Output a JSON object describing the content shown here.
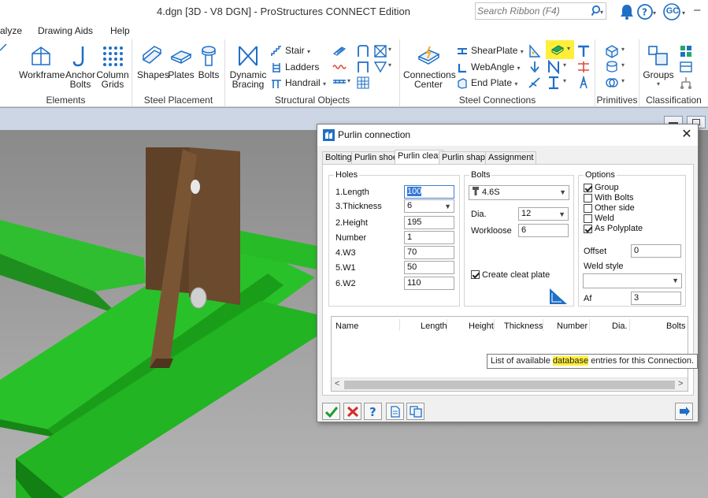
{
  "titlebar": {
    "title": "4.dgn [3D - V8 DGN] - ProStructures CONNECT Edition",
    "search_placeholder": "Search Ribbon (F4)",
    "user_initials": "GC"
  },
  "menu": {
    "tabs": [
      "alyze",
      "Drawing Aids",
      "Help"
    ]
  },
  "ribbon": {
    "elements": {
      "label": "Elements",
      "buttons": [
        "Workframe",
        "Anchor",
        "Bolts",
        "Column",
        "Grids"
      ]
    },
    "steel_placement": {
      "label": "Steel Placement",
      "buttons": [
        "Shapes",
        "Plates",
        "Bolts"
      ]
    },
    "structural_objects": {
      "label": "Structural Objects",
      "dynamic": [
        "Dynamic",
        "Bracing"
      ],
      "stair": "Stair",
      "ladders": "Ladders",
      "handrail": "Handrail"
    },
    "steel_connections": {
      "label": "Steel Connections",
      "center": [
        "Connections",
        "Center"
      ],
      "shearplate": "ShearPlate",
      "webangle": "WebAngle",
      "endplate": "End Plate"
    },
    "primitives": {
      "label": "Primitives"
    },
    "classification": {
      "label": "Classification",
      "groups": "Groups"
    }
  },
  "dialog": {
    "title": "Purlin connection",
    "tabs": [
      "Bolting",
      "Purlin shoe",
      "Purlin cleat",
      "Purlin shape",
      "Assignment"
    ],
    "holes": {
      "title": "Holes",
      "length_label": "1.Length",
      "length_value": "100",
      "thickness_label": "3.Thickness",
      "thickness_value": "6",
      "height_label": "2.Height",
      "height_value": "195",
      "number_label": "Number",
      "number_value": "1",
      "w3_label": "4.W3",
      "w3_value": "70",
      "w1_label": "5.W1",
      "w1_value": "50",
      "w2_label": "6.W2",
      "w2_value": "110"
    },
    "bolts": {
      "title": "Bolts",
      "grade_value": "4.6S",
      "dia_label": "Dia.",
      "dia_value": "12",
      "workloose_label": "Workloose",
      "workloose_value": "6",
      "create_cleat_label": "Create cleat plate"
    },
    "options": {
      "title": "Options",
      "group_label": "Group",
      "with_bolts_label": "With Bolts",
      "other_side_label": "Other side",
      "weld_label": "Weld",
      "as_polyplate_label": "As Polyplate",
      "offset_label": "Offset",
      "offset_value": "0",
      "weld_style_label": "Weld style",
      "weld_style_value": "",
      "af_label": "Af",
      "af_value": "3"
    },
    "grid": {
      "columns": [
        "Name",
        "Length",
        "Height",
        "Thickness",
        "Number",
        "Dia.",
        "Bolts"
      ]
    },
    "tooltip": {
      "before": "List of available ",
      "highlight": "database",
      "after": " entries for this Connection."
    }
  },
  "colors": {
    "accent_blue": "#1f6fc5",
    "highlight_yellow": "#ffef3a",
    "steel_green": "#22c322",
    "plate_brown": "#6b4a2e"
  }
}
